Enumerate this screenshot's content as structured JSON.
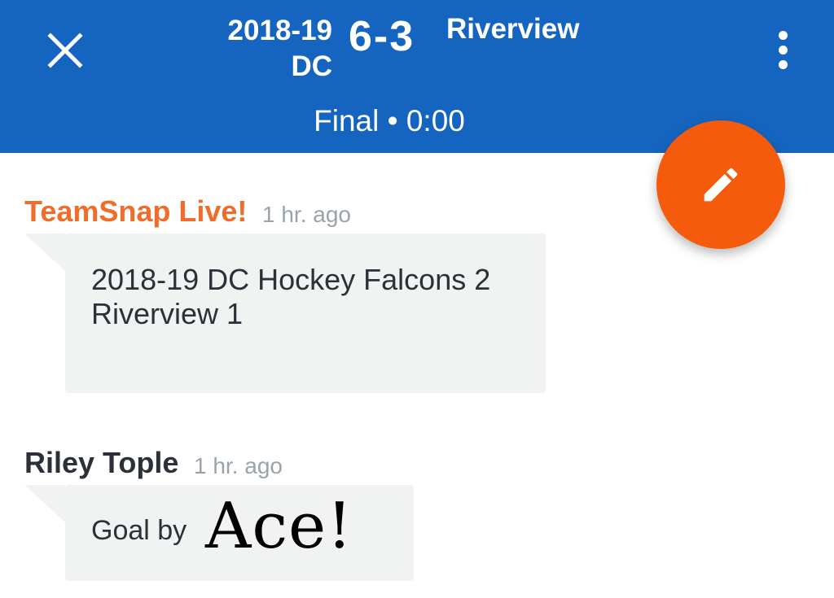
{
  "header": {
    "close_icon": "close-icon",
    "home_team": "2018-19 DC",
    "score": "6-3",
    "away_team": "Riverview",
    "status": "Final • 0:00",
    "more_icon": "more-vertical-icon",
    "background_color": "#1565c0"
  },
  "fab": {
    "icon": "pencil-icon",
    "color": "#f45b0c"
  },
  "messages": [
    {
      "author": "TeamSnap Live!",
      "author_color": "#ef6c2a",
      "time": "1 hr. ago",
      "text": "2018-19 DC Hockey Falcons 2 Riverview 1"
    },
    {
      "author": "Riley Tople",
      "author_color": "#2c3038",
      "time": "1 hr. ago",
      "text": "Goal by",
      "overlay": "Ace!"
    }
  ]
}
